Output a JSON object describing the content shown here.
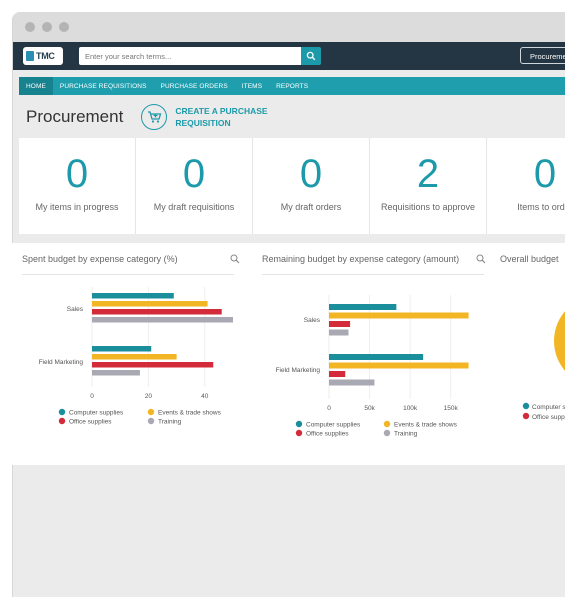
{
  "window": {
    "controls": [
      "close",
      "minimize",
      "maximize"
    ]
  },
  "appbar": {
    "logo_text": "TMC",
    "search_placeholder": "Enter your search terms...",
    "search_icon": "search-icon",
    "module_button": "Procurement"
  },
  "nav": {
    "items": [
      "HOME",
      "PURCHASE REQUISITIONS",
      "PURCHASE ORDERS",
      "ITEMS",
      "REPORTS"
    ],
    "active": "HOME"
  },
  "header": {
    "title": "Procurement",
    "create_line1": "CREATE A PURCHASE",
    "create_line2": "REQUISITION",
    "create_icon": "cart-icon"
  },
  "kpis": [
    {
      "value": "0",
      "label": "My items in progress"
    },
    {
      "value": "0",
      "label": "My draft requisitions"
    },
    {
      "value": "0",
      "label": "My draft orders"
    },
    {
      "value": "2",
      "label": "Requisitions to approve"
    },
    {
      "value": "0",
      "label": "Items to order"
    }
  ],
  "colors": {
    "accent": "#1d9aaa",
    "computer_supplies": "#1b8e9c",
    "events_trade_shows": "#f2b625",
    "office_supplies": "#d32b3a",
    "training": "#a8a9b2"
  },
  "charts": {
    "spent": {
      "title": "Spent budget by expense category (%)",
      "chart_data": {
        "type": "bar",
        "orientation": "horizontal",
        "categories": [
          "Sales",
          "Field Marketing"
        ],
        "series": [
          {
            "name": "Computer supplies",
            "values": [
              29,
              21
            ]
          },
          {
            "name": "Events & trade shows",
            "values": [
              41,
              30
            ]
          },
          {
            "name": "Office supplies",
            "values": [
              46,
              43
            ]
          },
          {
            "name": "Training",
            "values": [
              50,
              17
            ]
          }
        ],
        "xlim": [
          0,
          50
        ],
        "xticks": [
          "0",
          "20",
          "40"
        ],
        "xtick_values": [
          0,
          20,
          40
        ],
        "legend": "bottom"
      }
    },
    "remaining": {
      "title": "Remaining budget by expense category (amount)",
      "chart_data": {
        "type": "bar",
        "orientation": "horizontal",
        "categories": [
          "Sales",
          "Field Marketing"
        ],
        "series": [
          {
            "name": "Computer supplies",
            "values": [
              83000,
              116000
            ]
          },
          {
            "name": "Events & trade shows",
            "values": [
              172000,
              172000
            ]
          },
          {
            "name": "Office supplies",
            "values": [
              26000,
              20000
            ]
          },
          {
            "name": "Training",
            "values": [
              24000,
              56000
            ]
          }
        ],
        "xlim": [
          0,
          175000
        ],
        "xticks": [
          "0",
          "50k",
          "100k",
          "150k"
        ],
        "xtick_values": [
          0,
          50000,
          100000,
          150000
        ],
        "legend": "bottom"
      }
    },
    "overall": {
      "title": "Overall budget",
      "legend": [
        "Computer supplies",
        "Office supplies"
      ]
    }
  }
}
